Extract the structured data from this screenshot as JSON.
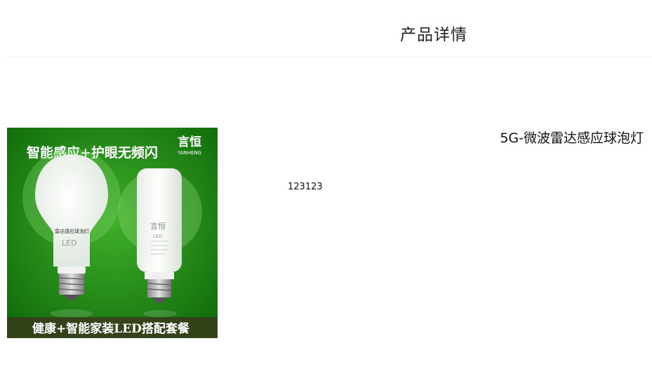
{
  "header": {
    "title": "产品详情"
  },
  "product": {
    "name": "5G-微波雷达感应球泡灯",
    "description": "123123",
    "image": {
      "banner_top": "智能感应+护眼无频闪",
      "brand_cn": "言恒",
      "brand_en": "YANHENG",
      "bulb_label": "雷达感应球泡灯",
      "bulb_led": "LED",
      "tube_brand": "言恒",
      "tube_led": "LED",
      "banner_bottom": "健康+智能家装LED搭配套餐"
    }
  },
  "colors": {
    "image_background": "#1f8a14",
    "bottom_banner": "#3a3a1c",
    "banner_text": "#ffffff"
  }
}
